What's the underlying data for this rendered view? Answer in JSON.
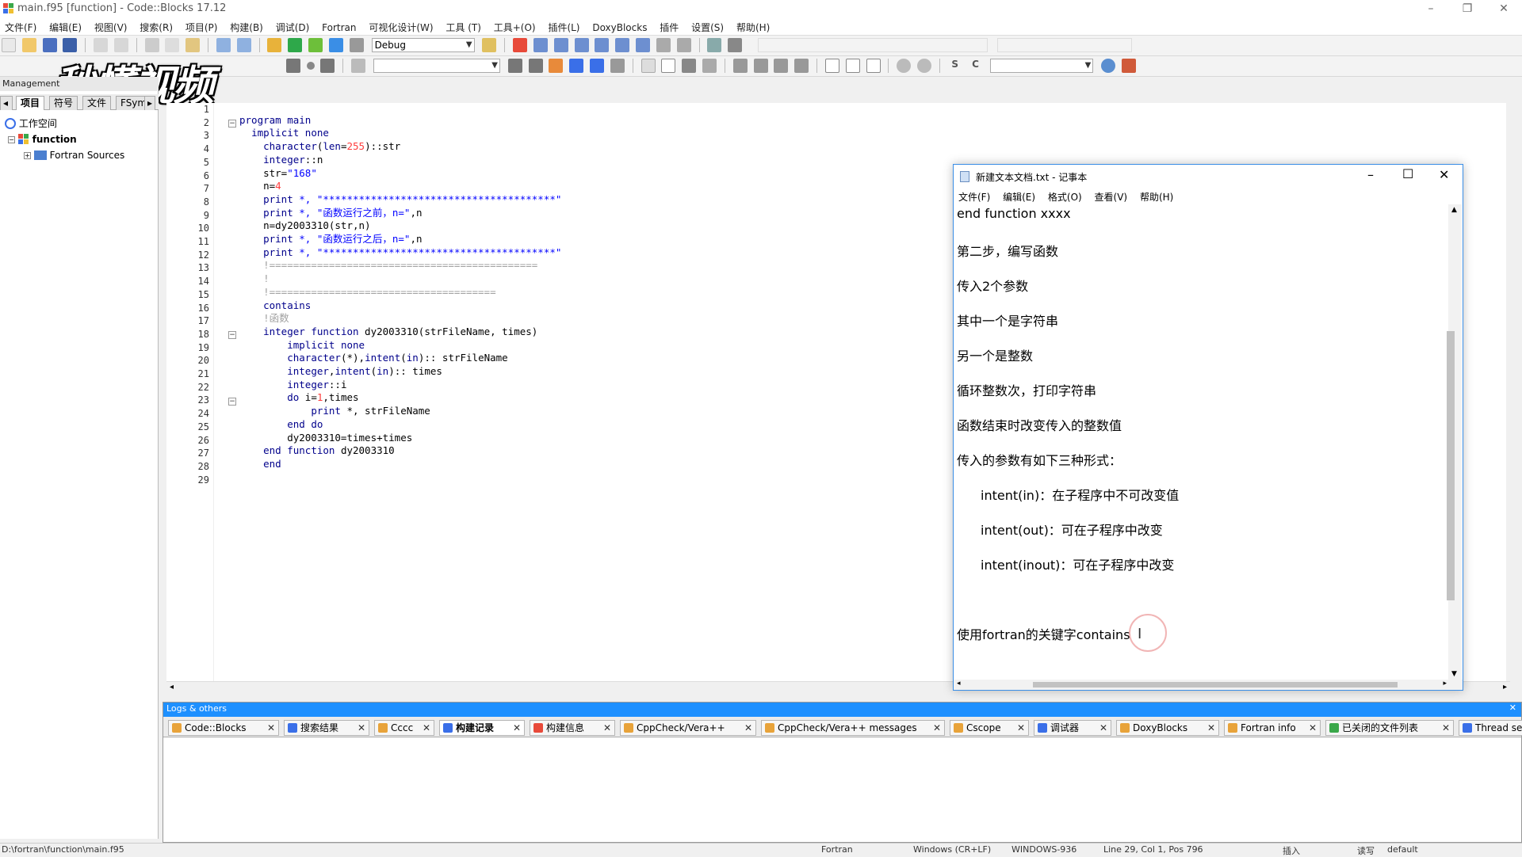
{
  "window": {
    "title": "main.f95 [function] - Code::Blocks 17.12",
    "minimize": "–",
    "restore": "❐",
    "close": "✕"
  },
  "menu": [
    "文件(F)",
    "编辑(E)",
    "视图(V)",
    "搜索(R)",
    "项目(P)",
    "构建(B)",
    "调试(D)",
    "Fortran",
    "可视化设计(W)",
    "工具 (T)",
    "工具+(O)",
    "插件(L)",
    "DoxyBlocks",
    "插件",
    "设置(S)",
    "帮助(H)"
  ],
  "toolbar": {
    "build_target": "Debug"
  },
  "watermark": "秒懂视频",
  "management": {
    "header": "Management",
    "tabs": [
      "项目",
      "符号",
      "文件",
      "FSym"
    ],
    "active_tab": "项目",
    "tree": {
      "workspace": "工作空间",
      "project": "function",
      "folder": "Fortran Sources"
    }
  },
  "editor": {
    "line_numbers": [
      "1",
      "2",
      "3",
      "4",
      "5",
      "6",
      "7",
      "8",
      "9",
      "10",
      "11",
      "12",
      "13",
      "14",
      "15",
      "16",
      "17",
      "18",
      "19",
      "20",
      "21",
      "22",
      "23",
      "24",
      "25",
      "26",
      "27",
      "28",
      "29"
    ]
  },
  "notepad": {
    "title": "新建文本文档.txt - 记事本",
    "menu": [
      "文件(F)",
      "编辑(E)",
      "格式(O)",
      "查看(V)",
      "帮助(H)"
    ],
    "lines": [
      "end function xxxx",
      "第二步，编写函数",
      "传入2个参数",
      "其中一个是字符串",
      "另一个是整数",
      "循环整数次，打印字符串",
      "函数结束时改变传入的整数值",
      "传入的参数有如下三种形式：",
      "intent(in)：在子程序中不可改变值",
      "intent(out)：可在子程序中改变",
      "intent(inout)：可在子程序中改变",
      "使用fortran的关键字contains"
    ]
  },
  "logs": {
    "header": "Logs & others",
    "tabs": [
      {
        "label": "Code::Blocks",
        "color": "#e8a33a"
      },
      {
        "label": "搜索结果",
        "color": "#3a6fe8"
      },
      {
        "label": "Cccc",
        "color": "#e8a33a"
      },
      {
        "label": "构建记录",
        "color": "#3a6fe8",
        "active": true
      },
      {
        "label": "构建信息",
        "color": "#e84a3a"
      },
      {
        "label": "CppCheck/Vera++",
        "color": "#e8a33a"
      },
      {
        "label": "CppCheck/Vera++ messages",
        "color": "#e8a33a"
      },
      {
        "label": "Cscope",
        "color": "#e8a33a"
      },
      {
        "label": "调试器",
        "color": "#3a6fe8"
      },
      {
        "label": "DoxyBlocks",
        "color": "#e8a33a"
      },
      {
        "label": "Fortran info",
        "color": "#e8a33a"
      },
      {
        "label": "已关闭的文件列表",
        "color": "#3aa84a"
      },
      {
        "label": "Thread search",
        "color": "#3a6fe8"
      }
    ]
  },
  "status": {
    "path": "D:\\fortran\\function\\main.f95",
    "language": "Fortran",
    "eol": "Windows (CR+LF)",
    "encoding": "WINDOWS-936",
    "position": "Line 29, Col 1, Pos 796",
    "mode": "插入",
    "rw": "读写",
    "profile": "default"
  }
}
